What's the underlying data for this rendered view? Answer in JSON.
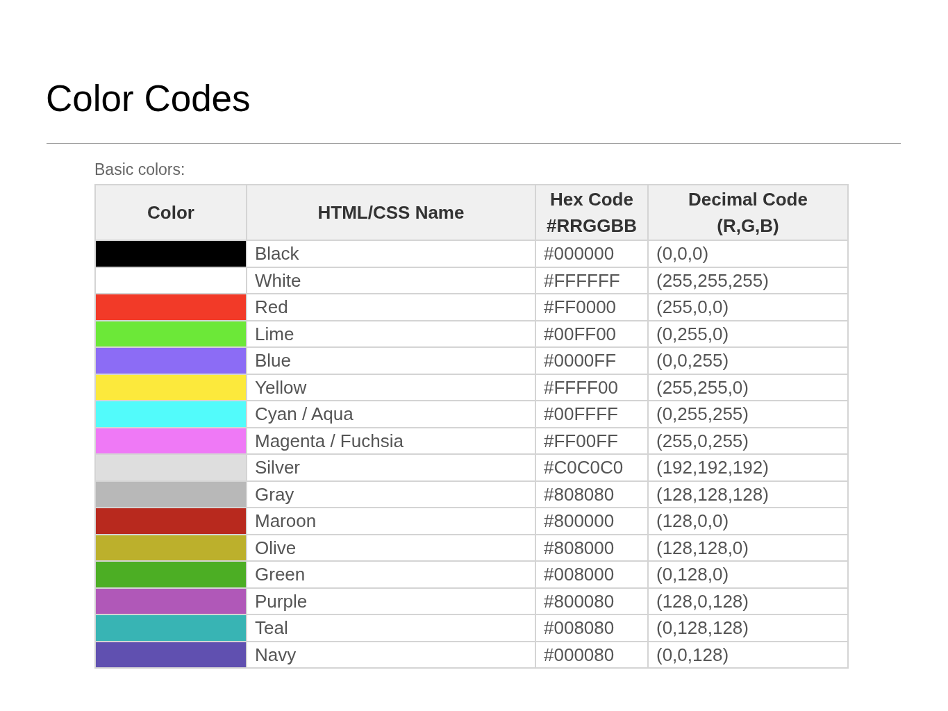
{
  "title": "Color Codes",
  "caption": "Basic colors:",
  "table": {
    "columns": [
      {
        "lines": [
          "Color"
        ]
      },
      {
        "lines": [
          "HTML/CSS Name"
        ]
      },
      {
        "lines": [
          "Hex Code",
          "#RRGGBB"
        ]
      },
      {
        "lines": [
          "Decimal Code",
          "(R,G,B)"
        ]
      }
    ],
    "rows": [
      {
        "color": "#000000",
        "name": "Black",
        "hex": "#000000",
        "decimal": "(0,0,0)"
      },
      {
        "color": "#ffffff",
        "name": "White",
        "hex": "#FFFFFF",
        "decimal": "(255,255,255)"
      },
      {
        "color": "#f23a28",
        "name": "Red",
        "hex": "#FF0000",
        "decimal": "(255,0,0)"
      },
      {
        "color": "#6ce838",
        "name": "Lime",
        "hex": "#00FF00",
        "decimal": "(0,255,0)"
      },
      {
        "color": "#8c6cf5",
        "name": "Blue",
        "hex": "#0000FF",
        "decimal": "(0,0,255)"
      },
      {
        "color": "#fce93c",
        "name": "Yellow",
        "hex": "#FFFF00",
        "decimal": "(255,255,0)"
      },
      {
        "color": "#52fbfb",
        "name": "Cyan / Aqua",
        "hex": "#00FFFF",
        "decimal": "(0,255,255)"
      },
      {
        "color": "#ef79f6",
        "name": "Magenta / Fuchsia",
        "hex": "#FF00FF",
        "decimal": "(255,0,255)"
      },
      {
        "color": "#dedede",
        "name": "Silver",
        "hex": "#C0C0C0",
        "decimal": "(192,192,192)"
      },
      {
        "color": "#b8b8b8",
        "name": "Gray",
        "hex": "#808080",
        "decimal": "(128,128,128)"
      },
      {
        "color": "#b8291e",
        "name": "Maroon",
        "hex": "#800000",
        "decimal": "(128,0,0)"
      },
      {
        "color": "#bcb02c",
        "name": "Olive",
        "hex": "#808000",
        "decimal": "(128,128,0)"
      },
      {
        "color": "#4cae24",
        "name": "Green",
        "hex": "#008000",
        "decimal": "(0,128,0)"
      },
      {
        "color": "#b058b8",
        "name": "Purple",
        "hex": "#800080",
        "decimal": "(128,0,128)"
      },
      {
        "color": "#38b4b4",
        "name": "Teal",
        "hex": "#008080",
        "decimal": "(0,128,128)"
      },
      {
        "color": "#6050b0",
        "name": "Navy",
        "hex": "#000080",
        "decimal": "(0,0,128)"
      }
    ]
  }
}
